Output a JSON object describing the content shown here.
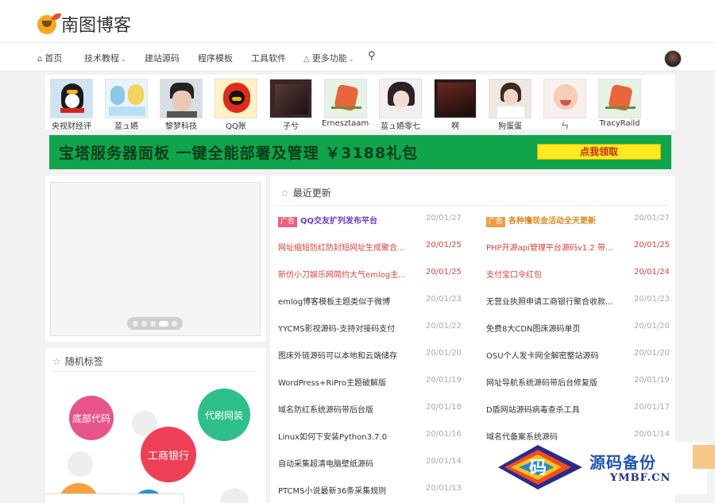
{
  "site": {
    "logo_text": "南图博客"
  },
  "nav": {
    "items": [
      {
        "label": "首页",
        "icon": "home-icon"
      },
      {
        "label": "技术教程",
        "dropdown": true
      },
      {
        "label": "建站源码"
      },
      {
        "label": "程序模板"
      },
      {
        "label": "工具软件"
      },
      {
        "label": "更多功能",
        "icon": "flask-icon",
        "dropdown": true
      }
    ],
    "search_icon": "search-icon"
  },
  "friends": [
    {
      "name": "央视财经评"
    },
    {
      "name": "莁ュ嬿"
    },
    {
      "name": "黎梦科技"
    },
    {
      "name": "QQ账"
    },
    {
      "name": "子兮"
    },
    {
      "name": "Ernesztaamomo"
    },
    {
      "name": "莁ュ嬿零七"
    },
    {
      "name": "啊"
    },
    {
      "name": "狗蛋蛋"
    },
    {
      "name": "ㄣ"
    },
    {
      "name": "TracyRaild"
    }
  ],
  "banner": {
    "text": "宝塔服务器面板 一键全能部署及管理 ￥3188礼包",
    "button": "点我领取",
    "bg_color": "#10a54a"
  },
  "tags_card": {
    "title": "随机标签",
    "tags": [
      {
        "label": "底部代码",
        "color": "#e8548a"
      },
      {
        "label": "代刷网装",
        "color": "#2fbf8a"
      },
      {
        "label": "工商银行",
        "color": "#ef3f57"
      }
    ]
  },
  "news": {
    "title": "最近更新",
    "ad_label": "广告",
    "left": [
      {
        "title": "QQ交友扩列发布平台",
        "date": "20/01/27",
        "ad": true,
        "color": "#6a3bc4"
      },
      {
        "title": "网址缩短防红防封短网址生成聚合...",
        "date": "20/01/25",
        "color": "#d9423c"
      },
      {
        "title": "新仿小刀娱乐网简约大气emlog主...",
        "date": "20/01/25",
        "color": "#d9423c"
      },
      {
        "title": "emlog博客模板主题类似于微博",
        "date": "20/01/23"
      },
      {
        "title": "YYCMS影视源码-支持对接码支付",
        "date": "20/01/22"
      },
      {
        "title": "图床外链源码可以本地和云端储存",
        "date": "20/01/20"
      },
      {
        "title": "WordPress+RiPro主题破解版",
        "date": "20/01/19"
      },
      {
        "title": "域名防红系统源码带后台版",
        "date": "20/01/18"
      },
      {
        "title": "Linux如何下安装Python3.7.0",
        "date": "20/01/16"
      },
      {
        "title": "自动采集超清电脑壁纸源码",
        "date": "20/01/14"
      },
      {
        "title": "PTCMS小说最新36条采集规则",
        "date": "20/01/13"
      }
    ],
    "right": [
      {
        "title": "各种撸现金活动全天更新",
        "date": "20/01/27",
        "ad": true,
        "color": "#d98a1c"
      },
      {
        "title": "PHP开源api管理平台源码v1.2 带...",
        "date": "20/01/25",
        "color": "#d9423c"
      },
      {
        "title": "支付宝口令红包",
        "date": "20/01/24",
        "color": "#d9423c"
      },
      {
        "title": "无营业执照申请工商银行聚合收款...",
        "date": "20/01/23"
      },
      {
        "title": "免费8大CDN图床源码单页",
        "date": "20/01/20"
      },
      {
        "title": "OSU个人发卡网全解密整站源码",
        "date": "20/01/20"
      },
      {
        "title": "网址导航系统源码带后台修复版",
        "date": "20/01/19"
      },
      {
        "title": "D盾网站源码病毒查杀工具",
        "date": "20/01/17"
      },
      {
        "title": "域名代备案系统源码",
        "date": "20/01/14"
      }
    ]
  },
  "watermark": {
    "line1": "源码备份",
    "line2": "YMBF.CN",
    "mark": "码"
  }
}
